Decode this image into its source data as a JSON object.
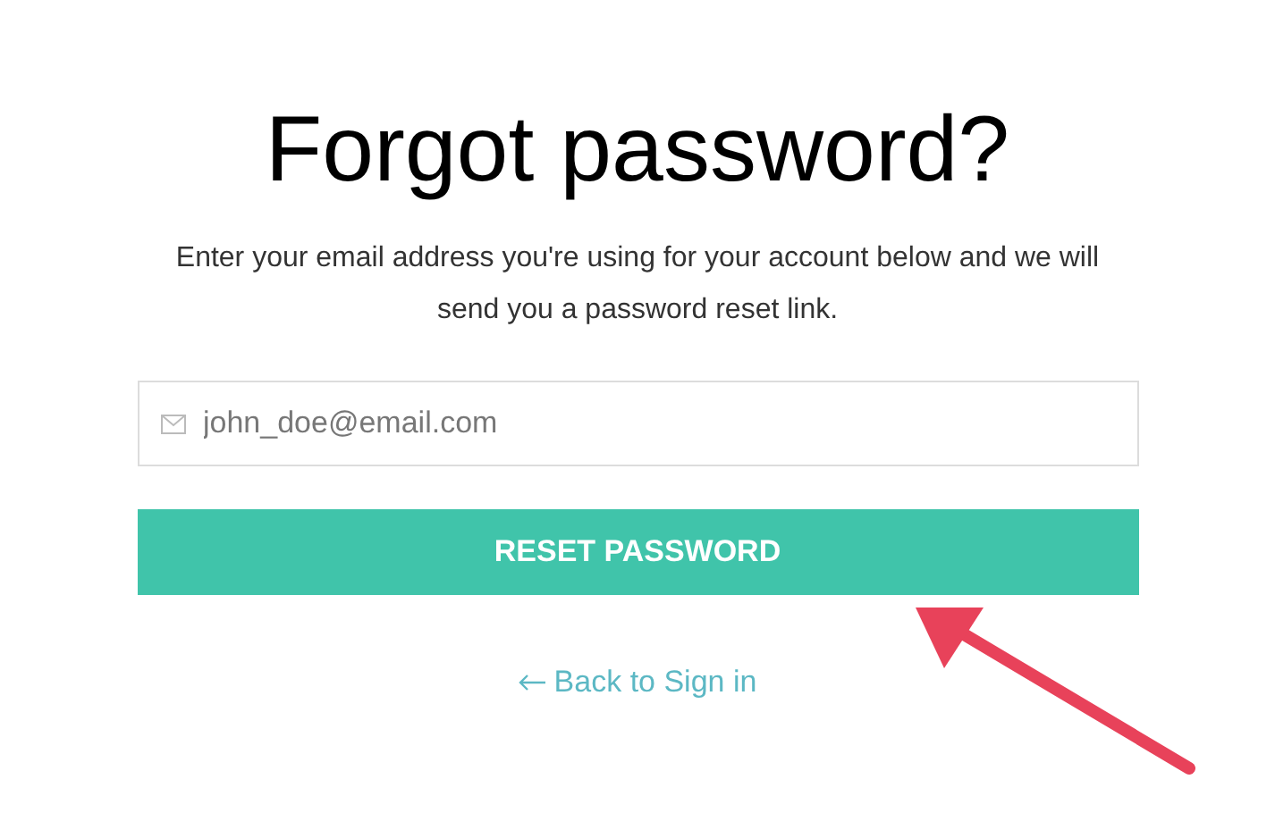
{
  "title": "Forgot password?",
  "description": "Enter your email address you're using for your account below and we will send you a password reset link.",
  "email_field": {
    "placeholder": "john_doe@email.com"
  },
  "reset_button": {
    "label": "RESET PASSWORD"
  },
  "back_link": {
    "label": "Back to Sign in"
  }
}
